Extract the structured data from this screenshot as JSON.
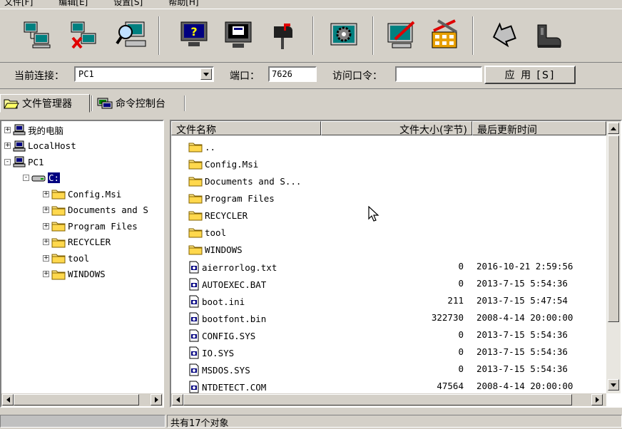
{
  "menubar": [
    "文件[F]",
    "编辑[E]",
    "设置[S]",
    "帮助[H]"
  ],
  "toolbar": {
    "icons": [
      "network-computers-icon",
      "disconnect-computers-icon",
      "search-computer-icon",
      "help-monitor-icon",
      "screen-view-icon",
      "mailbox-icon",
      "gear-panel-icon",
      "edit-monitor-icon",
      "tools-icon",
      "back-arrow-icon",
      "boot-icon"
    ]
  },
  "connection": {
    "label": "当前连接：",
    "value": "PC1",
    "port_label": "端口：",
    "port_value": "7626",
    "password_label": "访问口令：",
    "password_value": "",
    "apply_label": "应 用 [S]"
  },
  "tabs": [
    {
      "label": "文件管理器",
      "active": true
    },
    {
      "label": "命令控制台",
      "active": false
    }
  ],
  "tree": {
    "nodes": [
      {
        "label": "我的电脑",
        "level": 0,
        "expander": "+",
        "icon": "computer-icon"
      },
      {
        "label": "LocalHost",
        "level": 0,
        "expander": "+",
        "icon": "computer-icon"
      },
      {
        "label": "PC1",
        "level": 0,
        "expander": "-",
        "icon": "computer-icon"
      },
      {
        "label": "C:",
        "level": 1,
        "expander": "-",
        "icon": "drive-icon",
        "selected": true
      },
      {
        "label": "Config.Msi",
        "level": 2,
        "expander": "+",
        "icon": "folder-icon"
      },
      {
        "label": "Documents and S",
        "level": 2,
        "expander": "+",
        "icon": "folder-icon"
      },
      {
        "label": "Program Files",
        "level": 2,
        "expander": "+",
        "icon": "folder-icon"
      },
      {
        "label": "RECYCLER",
        "level": 2,
        "expander": "+",
        "icon": "folder-icon"
      },
      {
        "label": "tool",
        "level": 2,
        "expander": "+",
        "icon": "folder-icon"
      },
      {
        "label": "WINDOWS",
        "level": 2,
        "expander": "+",
        "icon": "folder-icon"
      }
    ]
  },
  "list": {
    "columns": [
      "文件名称",
      "文件大小(字节)",
      "最后更新时间"
    ],
    "rows": [
      {
        "name": "..",
        "size": "",
        "time": "",
        "type": "folder"
      },
      {
        "name": "Config.Msi",
        "size": "",
        "time": "",
        "type": "folder"
      },
      {
        "name": "Documents and S...",
        "size": "",
        "time": "",
        "type": "folder"
      },
      {
        "name": "Program Files",
        "size": "",
        "time": "",
        "type": "folder"
      },
      {
        "name": "RECYCLER",
        "size": "",
        "time": "",
        "type": "folder"
      },
      {
        "name": "tool",
        "size": "",
        "time": "",
        "type": "folder"
      },
      {
        "name": "WINDOWS",
        "size": "",
        "time": "",
        "type": "folder"
      },
      {
        "name": "aierrorlog.txt",
        "size": "0",
        "time": "2016-10-21 2:59:56",
        "type": "file"
      },
      {
        "name": "AUTOEXEC.BAT",
        "size": "0",
        "time": "2013-7-15 5:54:36",
        "type": "file"
      },
      {
        "name": "boot.ini",
        "size": "211",
        "time": "2013-7-15 5:47:54",
        "type": "file"
      },
      {
        "name": "bootfont.bin",
        "size": "322730",
        "time": "2008-4-14 20:00:00",
        "type": "file"
      },
      {
        "name": "CONFIG.SYS",
        "size": "0",
        "time": "2013-7-15 5:54:36",
        "type": "file"
      },
      {
        "name": "IO.SYS",
        "size": "0",
        "time": "2013-7-15 5:54:36",
        "type": "file"
      },
      {
        "name": "MSDOS.SYS",
        "size": "0",
        "time": "2013-7-15 5:54:36",
        "type": "file"
      },
      {
        "name": "NTDETECT.COM",
        "size": "47564",
        "time": "2008-4-14 20:00:00",
        "type": "file"
      }
    ]
  },
  "status": {
    "left": "",
    "right": "共有17个对象"
  }
}
